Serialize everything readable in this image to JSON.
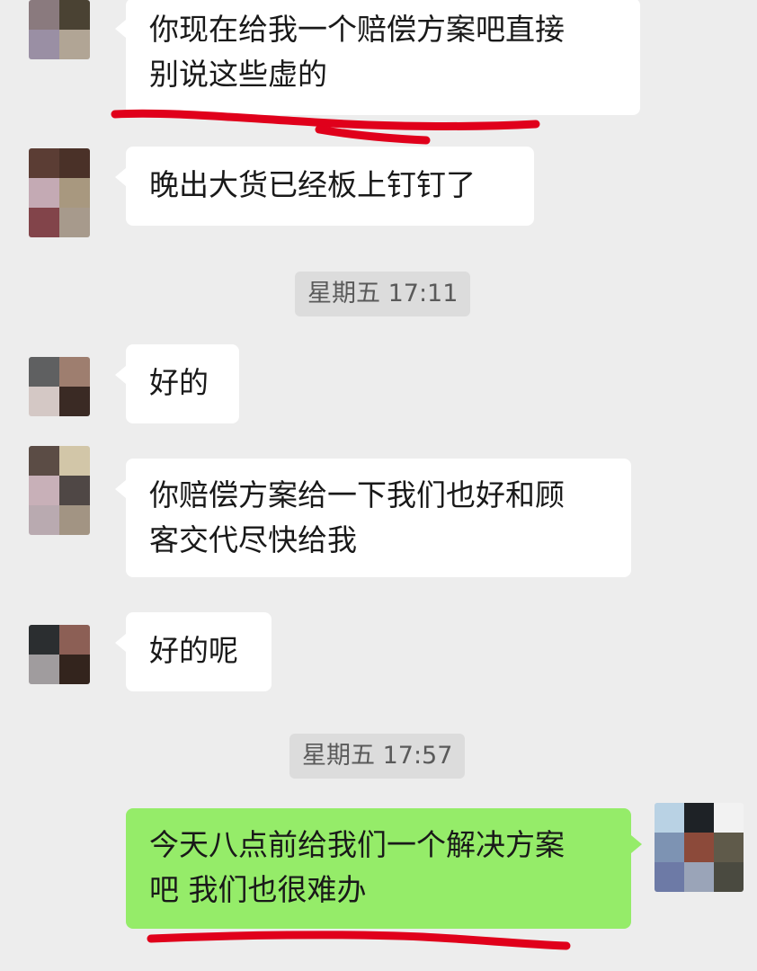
{
  "messages": [
    {
      "id": "m1",
      "side": "left",
      "text": "你现在给我一个赔偿方案吧直接\n别说这些虚的"
    },
    {
      "id": "m2",
      "side": "left",
      "text": "晚出大货已经板上钉钉了"
    },
    {
      "id": "m3",
      "side": "left",
      "text": "好的"
    },
    {
      "id": "m4",
      "side": "left",
      "text": "你赔偿方案给一下我们也好和顾\n客交代尽快给我"
    },
    {
      "id": "m5",
      "side": "left",
      "text": "好的呢"
    },
    {
      "id": "m6",
      "side": "right",
      "text": "今天八点前给我们一个解决方案\n吧 我们也很难办"
    }
  ],
  "timestamps": [
    {
      "id": "t1",
      "text": "星期五 17:11"
    },
    {
      "id": "t2",
      "text": "星期五 17:57"
    }
  ],
  "colors": {
    "background": "#ededed",
    "bubble_left": "#ffffff",
    "bubble_right": "#95ec69",
    "annotation_red": "#e0001b"
  }
}
